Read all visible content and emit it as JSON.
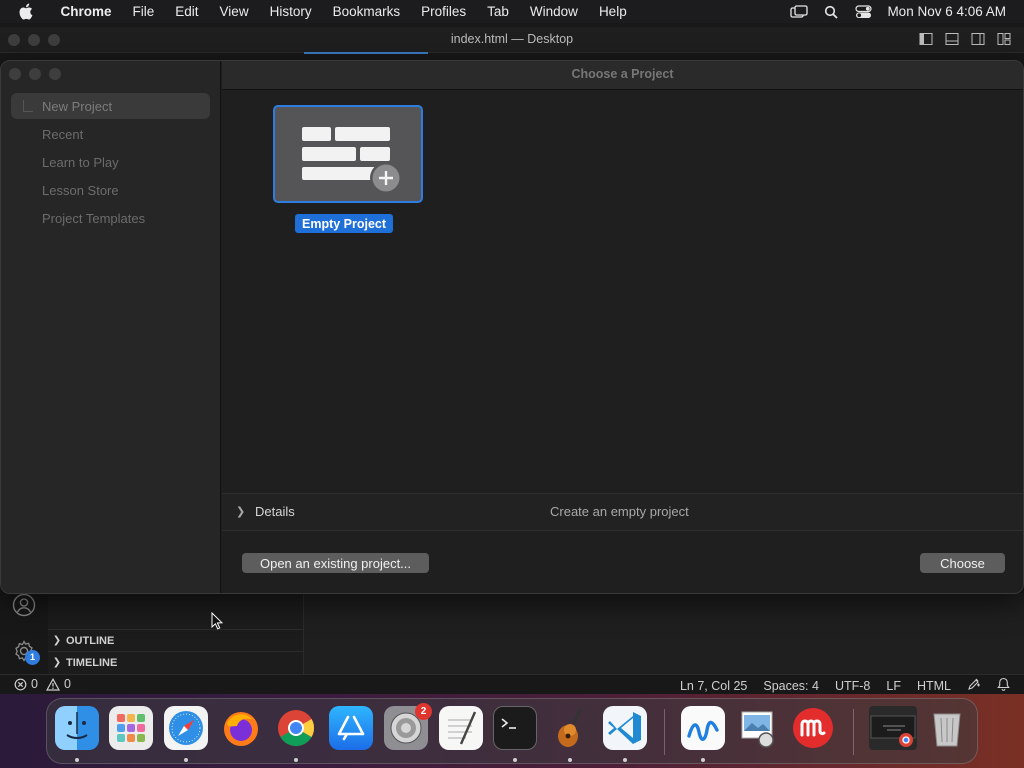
{
  "menubar": {
    "app": "Chrome",
    "items": [
      "File",
      "Edit",
      "View",
      "History",
      "Bookmarks",
      "Profiles",
      "Tab",
      "Window",
      "Help"
    ],
    "clock": "Mon Nov 6  4:06 AM",
    "icons": [
      "apple-icon",
      "screen-mirroring-icon",
      "spotlight-search-icon",
      "control-center-icon"
    ]
  },
  "vscode": {
    "title": "index.html — Desktop",
    "sections": [
      {
        "label": "OUTLINE"
      },
      {
        "label": "TIMELINE"
      }
    ],
    "manage_badge": "1",
    "status": {
      "errors": "0",
      "warnings": "0",
      "position": "Ln 7, Col 25",
      "spaces": "Spaces: 4",
      "encoding": "UTF-8",
      "eol": "LF",
      "language": "HTML"
    }
  },
  "chooser": {
    "header": "Choose a Project",
    "sidebar": [
      {
        "label": "New Project",
        "selected": true
      },
      {
        "label": "Recent"
      },
      {
        "label": "Learn to Play"
      },
      {
        "label": "Lesson Store"
      },
      {
        "label": "Project Templates"
      }
    ],
    "template": {
      "label": "Empty Project"
    },
    "details": {
      "label": "Details",
      "description": "Create an empty project"
    },
    "buttons": {
      "open": "Open an existing project...",
      "choose": "Choose"
    }
  },
  "dock": {
    "apps": [
      "Finder",
      "Launchpad",
      "Safari",
      "Firefox",
      "Google Chrome",
      "App Store",
      "System Settings",
      "TextEdit",
      "Terminal",
      "GarageBand",
      "Visual Studio Code",
      "Freeform",
      "Preview",
      "Mela",
      "Chrome Window",
      "Trash"
    ],
    "settings_badge": "2"
  },
  "colors": {
    "accent": "#1f6fd8",
    "selection_border": "#2f7de0",
    "badge_red": "#e0352f"
  }
}
